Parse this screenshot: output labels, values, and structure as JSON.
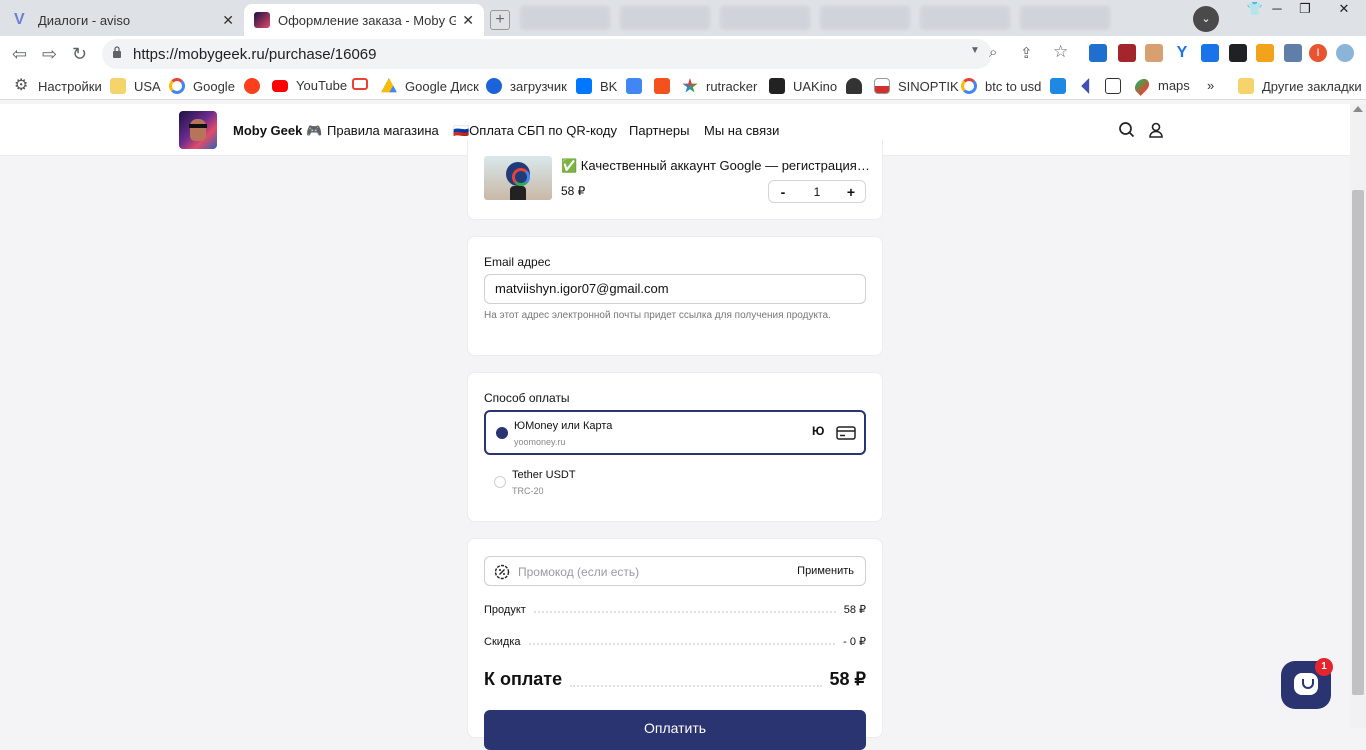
{
  "browser": {
    "tabs": [
      {
        "title": "Диалоги - aviso",
        "active": false
      },
      {
        "title": "Оформление заказа - Moby Geek",
        "active": true
      }
    ],
    "url": "https://mobygeek.ru/purchase/16069",
    "profile_initial": "I",
    "new_tab_symbol": "+",
    "close_symbol": "✕",
    "window_controls": {
      "minimize": "─",
      "maximize": "❐",
      "close": "✕"
    }
  },
  "bookmarks": [
    {
      "label": "Настройки",
      "icon": "gear-icon"
    },
    {
      "label": "USA",
      "icon": "folder-icon"
    },
    {
      "label": "Google",
      "icon": "google-icon"
    },
    {
      "label": "",
      "icon": "yandex-icon"
    },
    {
      "label": "YouTube",
      "icon": "youtube-icon"
    },
    {
      "label": "",
      "icon": "gmail-icon"
    },
    {
      "label": "Google Диск",
      "icon": "drive-icon"
    },
    {
      "label": "загрузчик",
      "icon": "loader-icon"
    },
    {
      "label": "BK",
      "icon": "vk-icon"
    },
    {
      "label": "",
      "icon": "translate-icon"
    },
    {
      "label": "",
      "icon": "f-icon"
    },
    {
      "label": "rutracker",
      "icon": "rutracker-icon"
    },
    {
      "label": "UAKino",
      "icon": "uakino-icon"
    },
    {
      "label": "",
      "icon": "figure-icon"
    },
    {
      "label": "SINOPTIK",
      "icon": "thermometer-icon"
    },
    {
      "label": "btc to usd",
      "icon": "google-icon"
    },
    {
      "label": "",
      "icon": "p-icon"
    },
    {
      "label": "",
      "icon": "arrow-icon"
    },
    {
      "label": "",
      "icon": "bc-icon"
    },
    {
      "label": "maps",
      "icon": "maps-icon"
    }
  ],
  "bookmarks_more": "»",
  "bookmarks_other": "Другие закладки",
  "site_nav": {
    "brand": "Moby Geek 🎮",
    "links": [
      "Правила магазина",
      "🇷🇺Оплата СБП по QR-коду",
      "Партнеры",
      "Мы на связи"
    ]
  },
  "product": {
    "title": "✅ Качественный аккаунт Google — регистрация н...",
    "price": "58 ₽",
    "quantity": "1",
    "minus": "-",
    "plus": "+"
  },
  "email": {
    "label": "Email адрес",
    "value": "matviishyn.igor07@gmail.com",
    "hint": "На этот адрес электронной почты придет ссылка для получения продукта."
  },
  "payment": {
    "label": "Способ оплаты",
    "options": [
      {
        "name": "ЮMoney или Карта",
        "sub": "yoomoney.ru",
        "selected": true,
        "yoomoney_mark": "Ю"
      },
      {
        "name": "Tether USDT",
        "sub": "TRC-20",
        "selected": false
      }
    ]
  },
  "summary": {
    "promo_placeholder": "Промокод (если есть)",
    "apply_label": "Применить",
    "product_label": "Продукт",
    "product_value": "58 ₽",
    "discount_label": "Скидка",
    "discount_value": "- 0 ₽",
    "total_label": "К оплате",
    "total_value": "58 ₽",
    "pay_button": "Оплатить"
  },
  "chat_badge": "1",
  "colors": {
    "accent": "#2a3470",
    "badge": "#e5252c"
  }
}
